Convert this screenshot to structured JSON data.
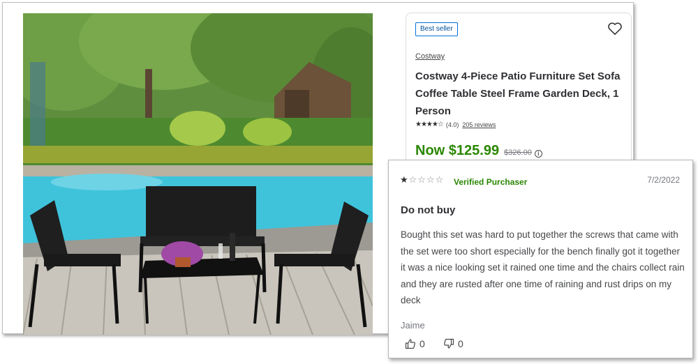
{
  "product": {
    "badge": "Best seller",
    "brand": "Costway",
    "title": "Costway 4-Piece Patio Furniture Set Sofa Coffee Table Steel Frame Garden Deck, 1 Person",
    "rating_stars": "★★★★☆",
    "rating_value": "(4.0)",
    "reviews_link": "205 reviews",
    "price_now": "Now $125.99",
    "price_was": "$326.00",
    "info_icon": "i",
    "icons": {
      "favorite": "heart-outline-icon",
      "info": "info-circle-icon"
    }
  },
  "review": {
    "stars_filled": "★",
    "stars_empty": "☆☆☆☆",
    "verified_label": "Verified Purchaser",
    "date": "7/2/2022",
    "title": "Do not buy",
    "body": "Bought this set was hard to put together the screws that came with the set were too short especially for the bench finally got it together it was a nice looking set it rained one time and the chairs collect rain and they are rusted after one time of raining and rust drips on my deck",
    "author": "Jaime",
    "helpful_count": "0",
    "unhelpful_count": "0",
    "icons": {
      "helpful": "thumbs-up-icon",
      "unhelpful": "thumbs-down-icon"
    }
  },
  "colors": {
    "price_green": "#2a8703",
    "badge_blue": "#0071dc",
    "text_dark": "#2e2f32"
  }
}
